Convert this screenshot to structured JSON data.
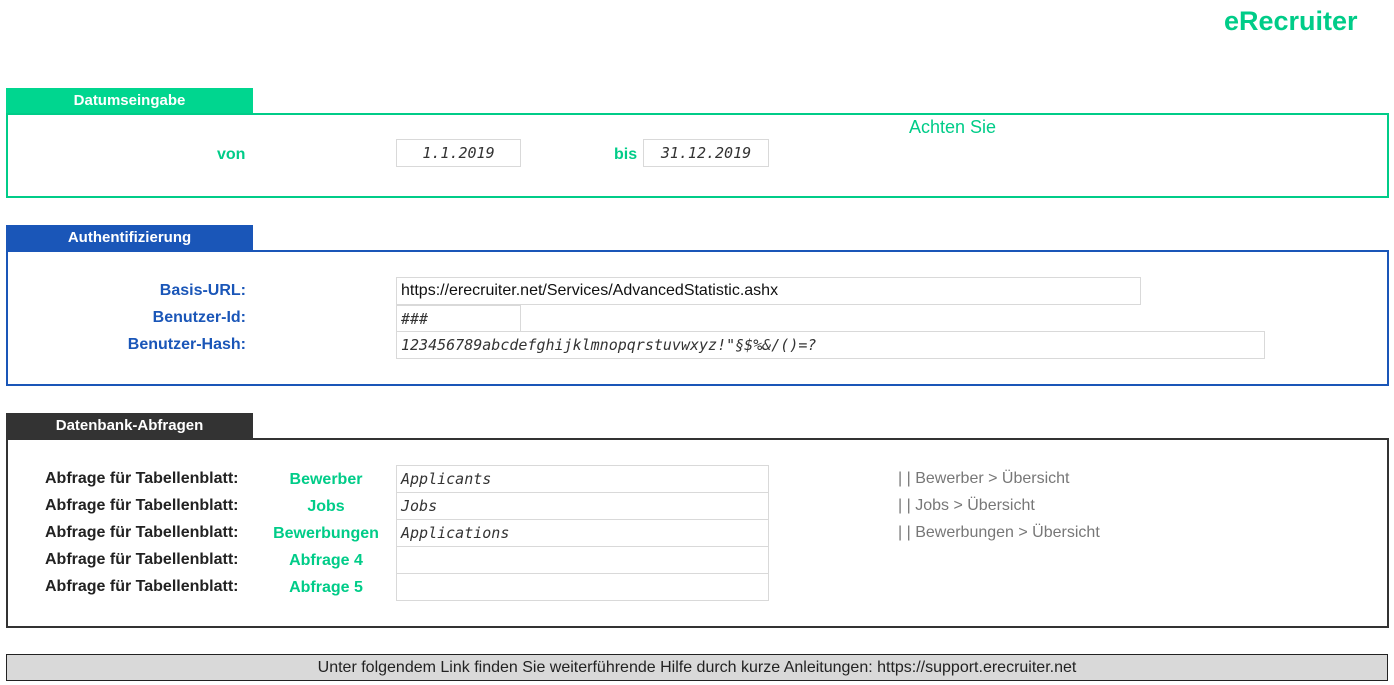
{
  "brand": {
    "logo": "eRecruiter",
    "accent": "#00cc88",
    "blue": "#1a56b8",
    "dark": "#333333"
  },
  "date_section": {
    "title": "Datumseingabe",
    "from_label": "von",
    "from_value": "1.1.2019",
    "to_label": "bis",
    "to_value": "31.12.2019",
    "note": "Achten Sie"
  },
  "auth_section": {
    "title": "Authentifizierung",
    "base_url_label": "Basis-URL:",
    "base_url_value": "https://erecruiter.net/Services/AdvancedStatistic.ashx",
    "user_id_label": "Benutzer-Id:",
    "user_id_value": "###",
    "user_hash_label": "Benutzer-Hash:",
    "user_hash_value": "123456789abcdefghijklmnopqrstuvwxyz!\"§$%&/()=?"
  },
  "db_section": {
    "title": "Datenbank-Abfragen",
    "rows": [
      {
        "label": "Abfrage für Tabellenblatt:",
        "sheet": "Bewerber",
        "query": "Applicants",
        "hint": "| | Bewerber > Übersicht"
      },
      {
        "label": "Abfrage für Tabellenblatt:",
        "sheet": "Jobs",
        "query": "Jobs",
        "hint": "| | Jobs > Übersicht"
      },
      {
        "label": "Abfrage für Tabellenblatt:",
        "sheet": "Bewerbungen",
        "query": "Applications",
        "hint": "| | Bewerbungen > Übersicht"
      },
      {
        "label": "Abfrage für Tabellenblatt:",
        "sheet": "Abfrage 4",
        "query": "",
        "hint": ""
      },
      {
        "label": "Abfrage für Tabellenblatt:",
        "sheet": "Abfrage 5",
        "query": "",
        "hint": ""
      }
    ]
  },
  "footer": {
    "text": "Unter folgendem Link finden Sie weiterführende Hilfe durch kurze Anleitungen: https://support.erecruiter.net"
  }
}
